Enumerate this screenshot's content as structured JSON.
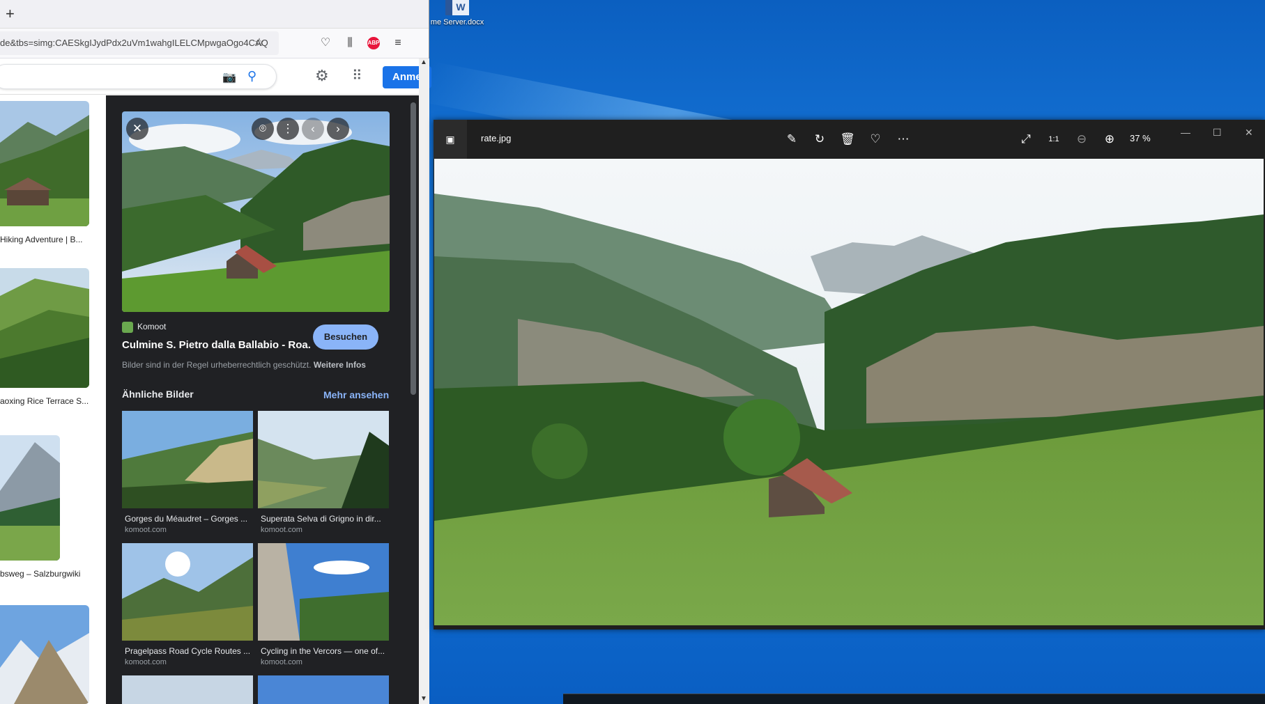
{
  "desktop": {
    "file_icon_label": "me Server.docx",
    "file_icon_glyph": "W"
  },
  "browser": {
    "newtab_glyph": "+",
    "url": "de&tbs=simg:CAESkgIJydPdx2uVm1wahgILELCMpwgaOgo4CAQ",
    "signin_label": "Anme",
    "results": [
      {
        "caption": "Hiking Adventure | B..."
      },
      {
        "caption": "aoxing Rice Terrace S..."
      },
      {
        "caption": "bsweg – Salzburgwiki"
      }
    ],
    "panel": {
      "source_name": "Komoot",
      "title": "Culmine S. Pietro dalla Ballabio - Roa...",
      "visit_label": "Besuchen",
      "copyright_text": "Bilder sind in der Regel urheberrechtlich geschützt.",
      "copyright_link": "Weitere Infos",
      "similar_heading": "Ähnliche Bilder",
      "more_label": "Mehr ansehen",
      "similar": [
        {
          "caption": "Gorges du Méaudret – Gorges ...",
          "domain": "komoot.com"
        },
        {
          "caption": "Superata Selva di Grigno in dir...",
          "domain": "komoot.com"
        },
        {
          "caption": "Pragelpass Road Cycle Routes ...",
          "domain": "komoot.com"
        },
        {
          "caption": "Cycling in the Vercors — one of...",
          "domain": "komoot.com"
        }
      ]
    }
  },
  "viewer": {
    "filename": "rate.jpg",
    "zoom": "37 %"
  },
  "colors": {
    "google_blue": "#1a73e8",
    "panel_bg": "#202124",
    "visit_button": "#8ab4f8",
    "desktop_blue": "#0a63c9"
  }
}
